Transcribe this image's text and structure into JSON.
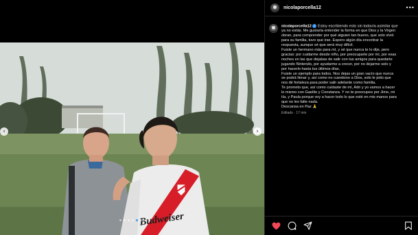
{
  "post": {
    "username": "nicolaporcella12",
    "caption_lines": [
      "Estoy escribiendo esto sin todavía asimilar que",
      "ya no estás. Me gustaría entender la forma en que Dios y la Virgen",
      "obran, para comprender por qué alguien tan bueno, que solo vivió",
      "para su familia, tuvo que irse. Espero algún día encontrar la",
      "respuesta, aunque sé que será muy difícil.",
      "Fuiste un hermano más para mí, y sé que nunca te lo dije, pero",
      "gracias: por cuidarme desde niño, por preocuparte por mí, por esas",
      "noches en las que dejabas de salir con tus amigos para quedarte",
      "jugando Nintendo, por ayudarme a crecer, por no dejarme solo y",
      "por hacerlo hasta tus últimos días.",
      "Fuiste un ejemplo para todos. Nos dejas un gran vacío que nunca",
      "se podrá llenar y, así como no cuestiono a Dios, solo le pido que",
      "nos dé fortaleza para poder salir adelante como familia.",
      "Te prometo que, así como cuidaste de mí, Adri y yo vamos a hacer",
      "lo mismo con Gaelito y Constanza. Y no te preocupes por Jime, mi",
      "tía, y Paula porque voy a hacer todo lo que esté en mis manos para",
      "que no les falte nada.",
      "Descansa en Paz 🙏"
    ],
    "edited_label": "Editado",
    "time": "17 min"
  },
  "jersey_text": "Budweiser",
  "carousel": {
    "count": 8,
    "active_index": 4
  },
  "colors": {
    "verified": "#3897f0",
    "like": "#ed4956",
    "jersey_red": "#d71e28"
  },
  "icons": [
    "more-icon",
    "heart-icon",
    "comment-icon",
    "share-icon",
    "bookmark-icon",
    "chevron-left-icon",
    "chevron-right-icon"
  ]
}
